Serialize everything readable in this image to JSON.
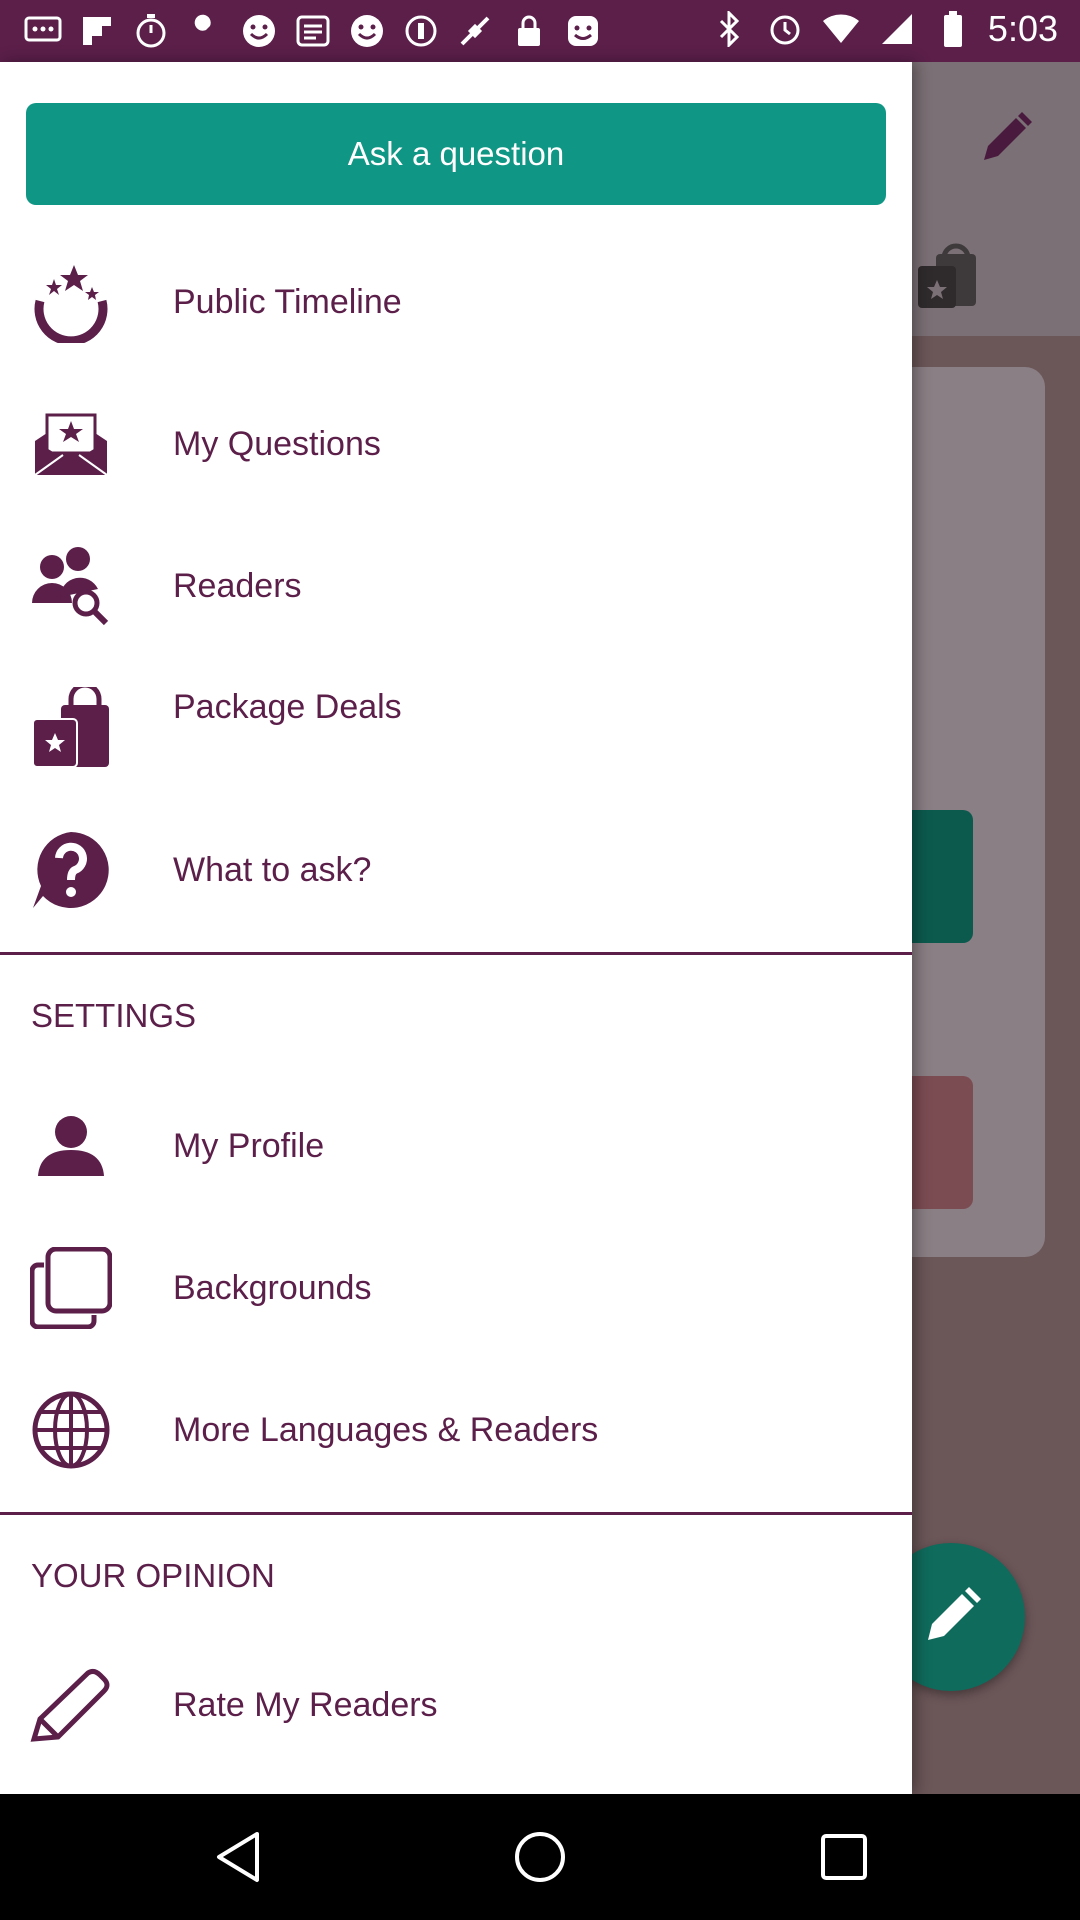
{
  "status_bar": {
    "time": "5:03",
    "left_icons": [
      "message-icon",
      "flipboard-icon",
      "stopwatch-icon",
      "wrench-icon",
      "smiley-icon",
      "app-icon",
      "smiley-icon",
      "circle-icon",
      "fake-gps-icon",
      "lock-icon",
      "smiley-icon"
    ],
    "right_icons": [
      "bluetooth-icon",
      "alarm-icon",
      "wifi-icon",
      "signal-icon",
      "battery-icon"
    ]
  },
  "drawer": {
    "ask_button": "Ask a question",
    "items": [
      {
        "label": "Public Timeline",
        "icon": "stars-moon-icon"
      },
      {
        "label": "My Questions",
        "icon": "envelope-star-icon"
      },
      {
        "label": "Readers",
        "icon": "users-search-icon"
      },
      {
        "label": "Package Deals",
        "icon": "shopping-bags-icon"
      },
      {
        "label": "What to ask?",
        "icon": "question-bubble-icon"
      }
    ],
    "settings_header": "SETTINGS",
    "settings_items": [
      {
        "label": "My Profile",
        "icon": "person-icon"
      },
      {
        "label": "Backgrounds",
        "icon": "layers-icon"
      },
      {
        "label": "More Languages & Readers",
        "icon": "globe-icon"
      }
    ],
    "opinion_header": "YOUR OPINION",
    "opinion_items": [
      {
        "label": "Rate My Readers",
        "icon": "pencil-icon"
      }
    ]
  },
  "colors": {
    "accent": "#0f9685",
    "brand": "#5b1f4a",
    "status_bar": "#5b1f4a"
  }
}
